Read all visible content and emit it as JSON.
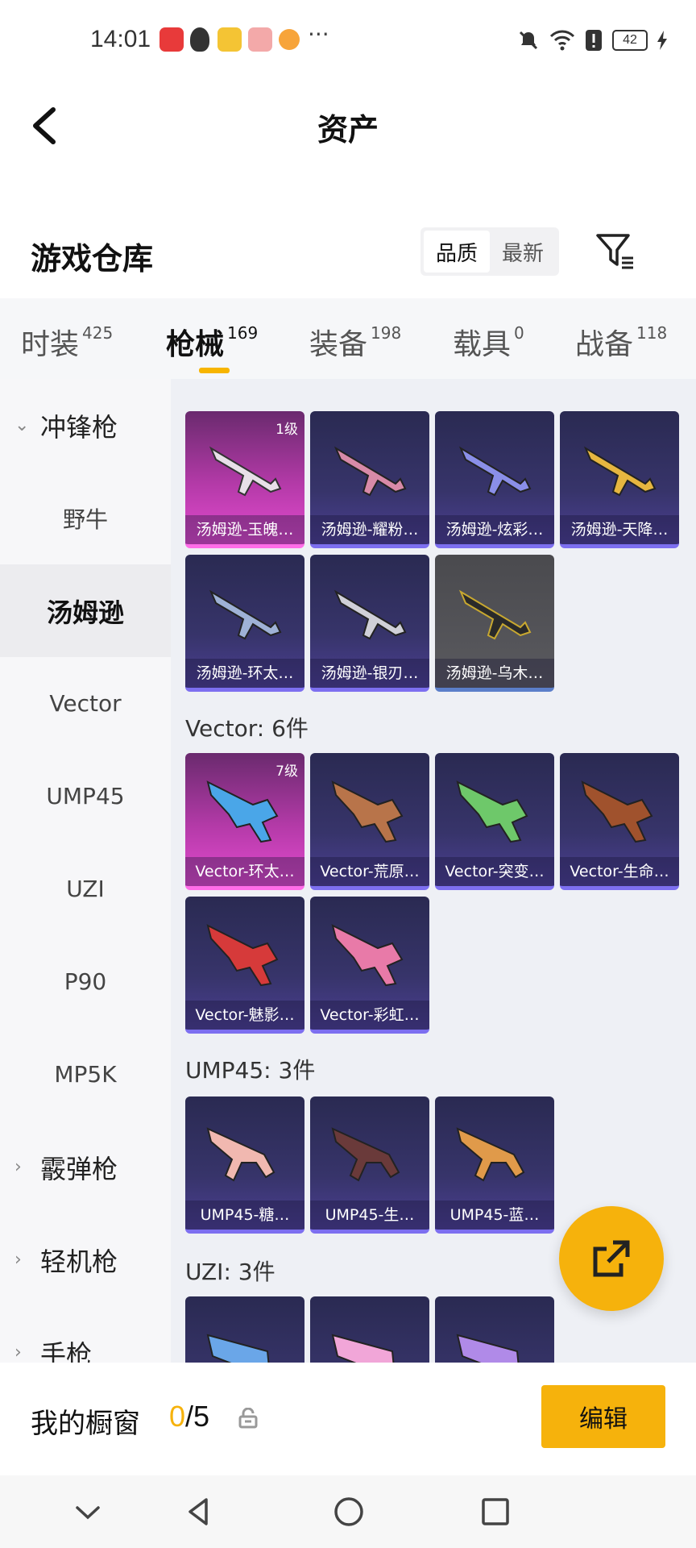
{
  "status_bar": {
    "time": "14:01",
    "dots": "···",
    "battery": "42"
  },
  "header": {
    "title": "资产"
  },
  "warehouse": {
    "title": "游戏仓库",
    "sort_options": [
      "品质",
      "最新"
    ]
  },
  "tabs": [
    {
      "label": "时装",
      "count": "425"
    },
    {
      "label": "枪械",
      "count": "169"
    },
    {
      "label": "装备",
      "count": "198"
    },
    {
      "label": "载具",
      "count": "0"
    },
    {
      "label": "战备",
      "count": "118"
    }
  ],
  "sidebar": {
    "items": [
      {
        "label": "冲锋枪"
      },
      {
        "label": "野牛"
      },
      {
        "label": "汤姆逊"
      },
      {
        "label": "Vector"
      },
      {
        "label": "UMP45"
      },
      {
        "label": "UZI"
      },
      {
        "label": "P90"
      },
      {
        "label": "MP5K"
      },
      {
        "label": "霰弹枪"
      },
      {
        "label": "轻机枪"
      },
      {
        "label": "手枪"
      }
    ]
  },
  "sections": {
    "thompson": {
      "items": [
        {
          "name": "汤姆逊-玉魄…",
          "level": "1级"
        },
        {
          "name": "汤姆逊-耀粉…"
        },
        {
          "name": "汤姆逊-炫彩…"
        },
        {
          "name": "汤姆逊-天降…"
        },
        {
          "name": "汤姆逊-环太…"
        },
        {
          "name": "汤姆逊-银刃…"
        },
        {
          "name": "汤姆逊-乌木…"
        }
      ]
    },
    "vector": {
      "title": "Vector: 6件",
      "items": [
        {
          "name": "Vector-环太…",
          "level": "7级"
        },
        {
          "name": "Vector-荒原…"
        },
        {
          "name": "Vector-突变…"
        },
        {
          "name": "Vector-生命…"
        },
        {
          "name": "Vector-魅影…"
        },
        {
          "name": "Vector-彩虹…"
        }
      ]
    },
    "ump45": {
      "title": "UMP45: 3件",
      "items": [
        {
          "name": "UMP45-糖…"
        },
        {
          "name": "UMP45-生…"
        },
        {
          "name": "UMP45-蓝…"
        }
      ]
    },
    "uzi": {
      "title": "UZI: 3件"
    }
  },
  "showcase": {
    "label": "我的橱窗",
    "current": "0",
    "total": "/5",
    "edit_label": "编辑"
  }
}
